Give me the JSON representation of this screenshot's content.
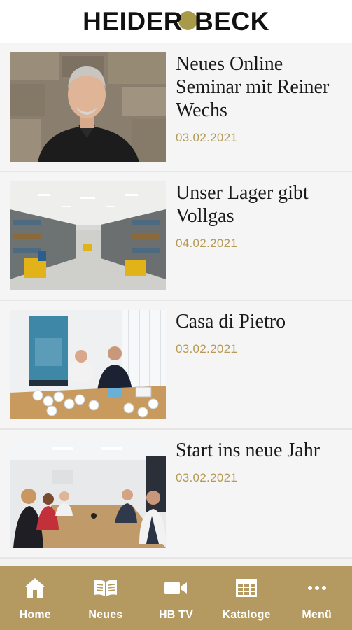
{
  "header": {
    "logo_left": "HEIDER",
    "logo_right": "BECK",
    "accent_color": "#a99a4a"
  },
  "feed": {
    "items": [
      {
        "title": "Neues Online Seminar mit Reiner Wechs",
        "date": "03.02.2021",
        "image": "portrait-photo"
      },
      {
        "title": "Unser Lager gibt Vollgas",
        "date": "04.02.2021",
        "image": "warehouse-photo"
      },
      {
        "title": "Casa di Pietro",
        "date": "03.02.2021",
        "image": "meeting-table-photo"
      },
      {
        "title": "Start ins neue Jahr",
        "date": "03.02.2021",
        "image": "conference-room-photo"
      }
    ]
  },
  "navbar": {
    "background": "#b49a61",
    "items": [
      {
        "label": "Home",
        "icon": "home-icon"
      },
      {
        "label": "Neues",
        "icon": "book-icon"
      },
      {
        "label": "HB TV",
        "icon": "video-camera-icon"
      },
      {
        "label": "Kataloge",
        "icon": "table-icon"
      },
      {
        "label": "Menü",
        "icon": "more-dots-icon"
      }
    ]
  }
}
